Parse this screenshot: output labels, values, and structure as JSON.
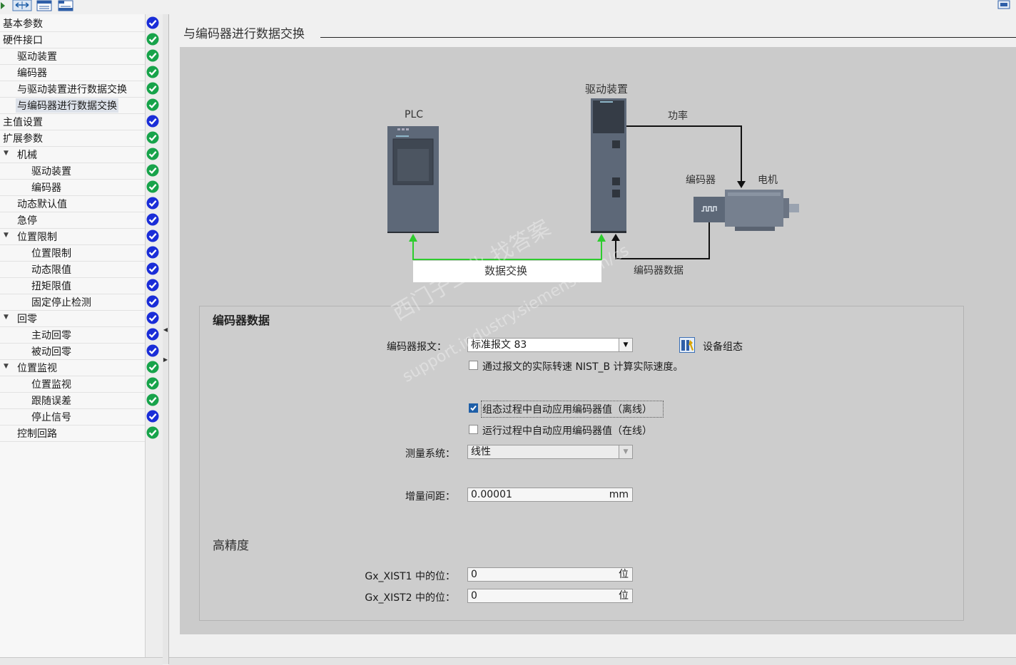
{
  "toolbar": {
    "icons": [
      "expand-arrow-icon",
      "toggle-view-icon",
      "list-view-icon",
      "tree-view-icon"
    ]
  },
  "nav": {
    "items": [
      {
        "label": "基本参数",
        "level": 0,
        "status": "blue"
      },
      {
        "label": "硬件接口",
        "level": 0,
        "status": "green"
      },
      {
        "label": "驱动装置",
        "level": 1,
        "status": "green"
      },
      {
        "label": "编码器",
        "level": 1,
        "status": "green"
      },
      {
        "label": "与驱动装置进行数据交换",
        "level": 1,
        "status": "green"
      },
      {
        "label": "与编码器进行数据交换",
        "level": 1,
        "status": "green",
        "selected": true
      },
      {
        "label": "主值设置",
        "level": 0,
        "status": "blue"
      },
      {
        "label": "扩展参数",
        "level": 0,
        "status": "green"
      },
      {
        "label": "机械",
        "level": 1,
        "status": "green",
        "expandable": true
      },
      {
        "label": "驱动装置",
        "level": 2,
        "status": "green"
      },
      {
        "label": "编码器",
        "level": 2,
        "status": "green"
      },
      {
        "label": "动态默认值",
        "level": 1,
        "status": "blue"
      },
      {
        "label": "急停",
        "level": 1,
        "status": "blue"
      },
      {
        "label": "位置限制",
        "level": 1,
        "status": "blue",
        "expandable": true
      },
      {
        "label": "位置限制",
        "level": 2,
        "status": "blue"
      },
      {
        "label": "动态限值",
        "level": 2,
        "status": "blue"
      },
      {
        "label": "扭矩限值",
        "level": 2,
        "status": "blue"
      },
      {
        "label": "固定停止检测",
        "level": 2,
        "status": "blue"
      },
      {
        "label": "回零",
        "level": 1,
        "status": "blue",
        "expandable": true
      },
      {
        "label": "主动回零",
        "level": 2,
        "status": "blue"
      },
      {
        "label": "被动回零",
        "level": 2,
        "status": "blue"
      },
      {
        "label": "位置监视",
        "level": 1,
        "status": "green",
        "expandable": true
      },
      {
        "label": "位置监视",
        "level": 2,
        "status": "green"
      },
      {
        "label": "跟随误差",
        "level": 2,
        "status": "green"
      },
      {
        "label": "停止信号",
        "level": 2,
        "status": "blue"
      },
      {
        "label": "控制回路",
        "level": 1,
        "status": "green"
      }
    ]
  },
  "colors": {
    "status_green": "#17a34a",
    "status_blue": "#1a2dd8",
    "signal_green": "#2ecc2e",
    "device_gray": "#5d6878",
    "panel_gray": "#cbcbcb"
  },
  "main": {
    "title": "与编码器进行数据交换",
    "diagram": {
      "plc_label": "PLC",
      "drive_label": "驱动装置",
      "power_label": "功率",
      "encoder_label": "编码器",
      "motor_label": "电机",
      "exchange_label": "数据交换",
      "encoder_data_label": "编码器数据"
    },
    "group": {
      "title": "编码器数据",
      "telegram_label": "编码器报文：",
      "telegram_value": "标准报文 83",
      "device_config_label": "设备组态",
      "nist_checkbox_label": "通过报文的实际转速 NIST_B 计算实际速度。",
      "nist_checked": false,
      "auto_offline_label": "组态过程中自动应用编码器值（离线）",
      "auto_offline_checked": true,
      "auto_online_label": "运行过程中自动应用编码器值（在线）",
      "auto_online_checked": false,
      "measure_label": "测量系统：",
      "measure_value": "线性",
      "increment_label": "增量间距：",
      "increment_value": "0.00001",
      "increment_unit": "mm",
      "precision_title": "高精度",
      "xist1_label": "Gx_XIST1 中的位：",
      "xist1_value": "0",
      "xist1_unit": "位",
      "xist2_label": "Gx_XIST2 中的位：",
      "xist2_value": "0",
      "xist2_unit": "位"
    }
  },
  "watermark": {
    "line1": "西门子工业 找答案",
    "line2": "support.industry.siemens.com/cs"
  }
}
